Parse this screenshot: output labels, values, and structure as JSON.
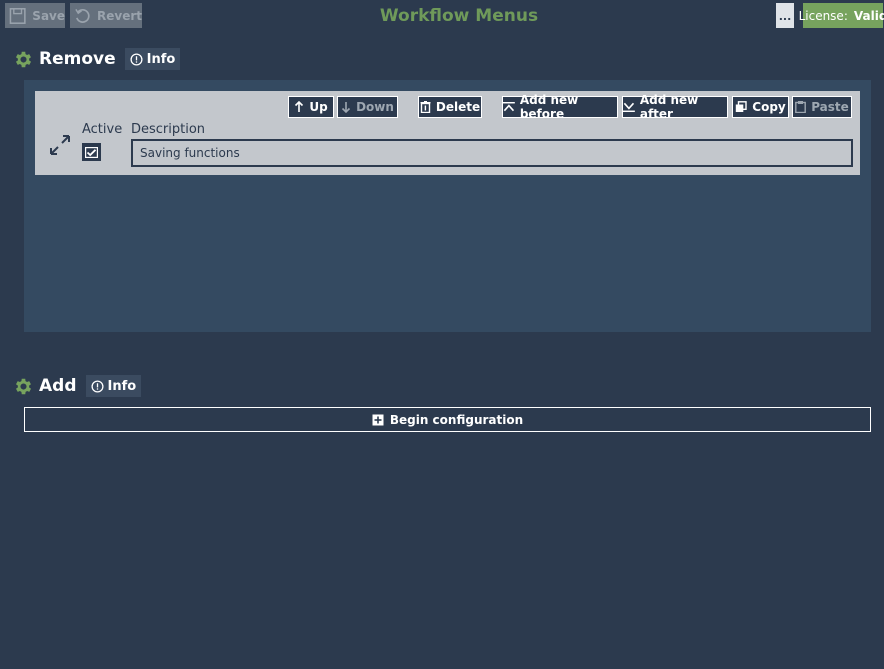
{
  "toolbar": {
    "save_label": "Save",
    "revert_label": "Revert",
    "more_label": "..."
  },
  "app_title": "Workflow Menus",
  "license": {
    "label": "License:",
    "status": "Valid"
  },
  "colors": {
    "background": "#2c3a4e",
    "accent_green": "#77a35e",
    "title_green": "#6f9a5a",
    "panel": "#344a61",
    "card": "#c3c7cc"
  },
  "sections": {
    "remove": {
      "title": "Remove",
      "info_label": "Info",
      "item_toolbar": {
        "up": "Up",
        "down": "Down",
        "delete": "Delete",
        "add_new_before": "Add new before",
        "add_new_after": "Add new after",
        "copy": "Copy",
        "paste": "Paste"
      },
      "item": {
        "active_label": "Active",
        "description_label": "Description",
        "active": true,
        "description": "Saving functions"
      }
    },
    "add": {
      "title": "Add",
      "info_label": "Info",
      "begin_label": "Begin configuration"
    }
  },
  "icons": [
    "save-icon",
    "revert-icon",
    "gear-icon",
    "info-icon",
    "arrow-up-icon",
    "arrow-down-icon",
    "trash-icon",
    "insert-before-icon",
    "insert-after-icon",
    "copy-icon",
    "paste-icon",
    "expand-icon",
    "checkmark-icon",
    "begin-config-icon"
  ]
}
